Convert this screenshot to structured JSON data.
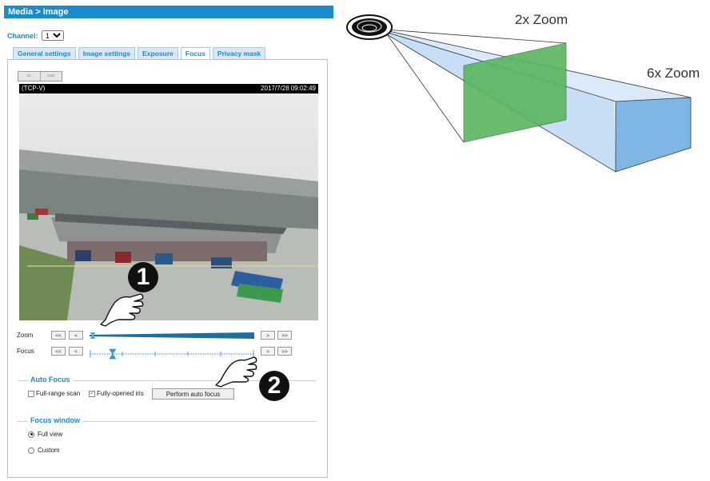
{
  "header": {
    "title": "Media  > Image"
  },
  "channel": {
    "label": "Channel:",
    "value": "1"
  },
  "tabs": [
    {
      "label": "General settings"
    },
    {
      "label": "Image settings"
    },
    {
      "label": "Exposure"
    },
    {
      "label": "Focus"
    },
    {
      "label": "Privacy mask"
    }
  ],
  "camera": {
    "name": "(TCP-V)",
    "timestamp": "2017/7/28 09:02:49"
  },
  "controls": {
    "zoom_label": "Zoom",
    "focus_label": "Focus",
    "left2": "<<",
    "left1": "<",
    "right1": ">",
    "right2": ">>",
    "zoom_level": 0,
    "focus_level": 0.14
  },
  "auto_focus": {
    "legend": "Auto Focus",
    "full_range_scan": "Full-range scan",
    "full_range_checked": false,
    "fully_opened_iris": "Fully-opened iris",
    "iris_checked": true,
    "button": "Perform auto focus"
  },
  "focus_window": {
    "legend": "Focus window",
    "full_view": "Full view",
    "custom": "Custom",
    "selected": "Full view"
  },
  "markers": {
    "one": "1",
    "two": "2"
  },
  "diagram": {
    "zoom_2x": "2x Zoom",
    "zoom_6x": "6x Zoom"
  },
  "colors": {
    "accent": "#1b8bcf",
    "green_plane": "#4caf3a",
    "blue_volume": "#7fb6e6"
  },
  "icons": {
    "pointer": "hand-pointer-icon",
    "camera": "dome-camera-icon"
  }
}
